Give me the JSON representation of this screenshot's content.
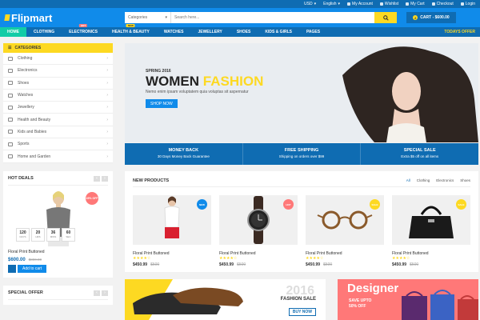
{
  "topbar": {
    "currency": "USD",
    "language": "English",
    "links": [
      "My Account",
      "Wishlist",
      "My Cart",
      "Checkout",
      "Login"
    ]
  },
  "header": {
    "logo": "Flipmart",
    "category_select": "Categories",
    "search_placeholder": "Search here...",
    "cart_label": "CART - $600.00",
    "cart_count": "2"
  },
  "nav": {
    "items": [
      "HOME",
      "CLOTHING",
      "ELECTRONICS",
      "HEALTH & BEAUTY",
      "WATCHES",
      "JEWELLERY",
      "SHOES",
      "KIDS & GIRLS",
      "PAGES"
    ],
    "tags": {
      "electronics": "HOT",
      "health": "NEW"
    },
    "offer": "TODAYS OFFER"
  },
  "sidebar": {
    "title": "CATEGORIES",
    "categories": [
      "Clothing",
      "Electronics",
      "Shoes",
      "Watches",
      "Jewellery",
      "Health and Beauty",
      "Kids and Babies",
      "Sports",
      "Home and Garden"
    ]
  },
  "hot_deals": {
    "title": "HOT DEALS",
    "badge": "49% OFF",
    "timer": [
      {
        "n": "120",
        "u": "DAYS"
      },
      {
        "n": "20",
        "u": "HRS"
      },
      {
        "n": "36",
        "u": "MINS"
      },
      {
        "n": "60",
        "u": "SEC"
      }
    ],
    "name": "Floral Print Buttoned",
    "price": "$600.00",
    "old_price": "$800.00",
    "add_to_cart": "Add to cart"
  },
  "special_offer": {
    "title": "SPECIAL OFFER"
  },
  "hero": {
    "kicker": "SPRING 2016",
    "title_a": "WOMEN ",
    "title_b": "FASHION",
    "desc": "Nemo enim ipsam voluptatem quia voluptas sit aspernatur",
    "button": "SHOP NOW"
  },
  "benefits": [
    {
      "title": "MONEY BACK",
      "sub": "30 Days Money Back Guarantee"
    },
    {
      "title": "FREE SHIPPING",
      "sub": "Shipping on orders over $99"
    },
    {
      "title": "SPECIAL SALE",
      "sub": "Extra $5 off on all items"
    }
  ],
  "new_products": {
    "title": "NEW PRODUCTS",
    "filters": [
      "All",
      "Clothing",
      "Electronics",
      "Shoes"
    ],
    "items": [
      {
        "name": "Floral Print Buttoned",
        "price": "$450.99",
        "old": "$500",
        "badge": "NEW",
        "badge_color": "#108bea",
        "rating": 4
      },
      {
        "name": "Floral Print Buttoned",
        "price": "$450.99",
        "old": "$500",
        "badge": "HOT",
        "badge_color": "#ff7878",
        "rating": 4
      },
      {
        "name": "Floral Print Buttoned",
        "price": "$450.99",
        "old": "$500",
        "badge": "SALE",
        "badge_color": "#fdd922",
        "rating": 4
      },
      {
        "name": "Floral Print Buttoned",
        "price": "$450.99",
        "old": "$500",
        "badge": "SALE",
        "badge_color": "#fdd922",
        "rating": 4
      }
    ]
  },
  "banners": {
    "fashion": {
      "year": "2016",
      "label": "FASHION SALE",
      "cta": "BUY NOW"
    },
    "designer": {
      "title": "Designer",
      "save": "SAVE UPTO 50% OFF"
    }
  },
  "colors": {
    "primary": "#108bea",
    "dark": "#0f6cb2",
    "accent": "#fdd922",
    "hot": "#ff7878",
    "active_nav": "#12cca7"
  }
}
